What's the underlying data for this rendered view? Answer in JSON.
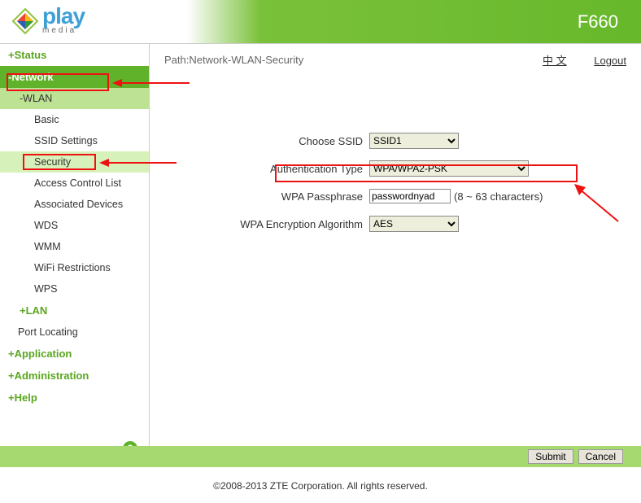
{
  "header": {
    "model": "F660",
    "logo_play": "play",
    "logo_media": "media"
  },
  "path": {
    "label": "Path:Network-WLAN-Security",
    "lang": "中 文",
    "logout": "Logout"
  },
  "sidebar": {
    "status": "+Status",
    "network": "-Network",
    "wlan": "-WLAN",
    "leafs": [
      "Basic",
      "SSID Settings",
      "Security",
      "Access Control List",
      "Associated Devices",
      "WDS",
      "WMM",
      "WiFi Restrictions",
      "WPS"
    ],
    "lan": "+LAN",
    "port": "Port Locating",
    "app": "+Application",
    "admin": "+Administration",
    "help": "+Help"
  },
  "form": {
    "ssid_label": "Choose SSID",
    "ssid_value": "SSID1",
    "auth_label": "Authentication Type",
    "auth_value": "WPA/WPA2-PSK",
    "pass_label": "WPA Passphrase",
    "pass_value": "passwordnyad",
    "pass_hint": "(8 ~ 63 characters)",
    "enc_label": "WPA Encryption Algorithm",
    "enc_value": "AES"
  },
  "buttons": {
    "submit": "Submit",
    "cancel": "Cancel"
  },
  "footer": "©2008-2013 ZTE Corporation. All rights reserved."
}
